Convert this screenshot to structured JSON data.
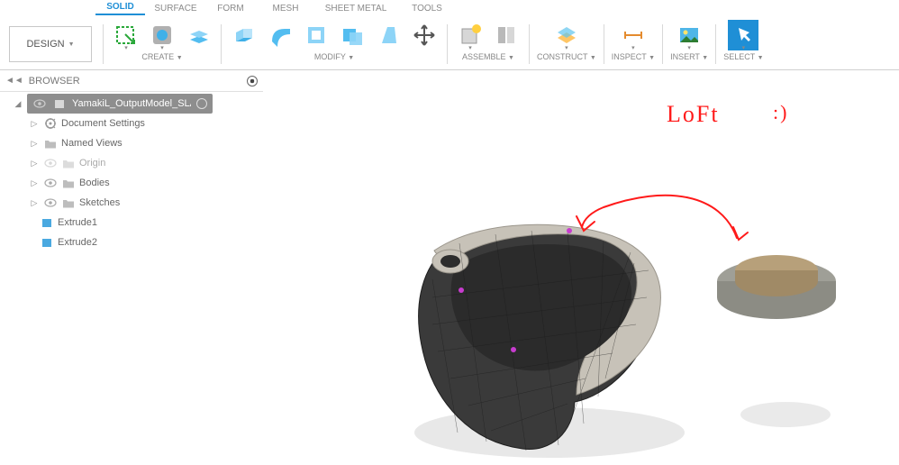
{
  "ribbon": {
    "design_label": "DESIGN",
    "tabs": {
      "solid": {
        "label": "SOLID",
        "active": true
      },
      "surface": {
        "label": "SURFACE",
        "active": false
      },
      "form": {
        "label": "FORM",
        "active": false
      },
      "mesh": {
        "label": "MESH",
        "active": false
      },
      "sheet": {
        "label": "SHEET METAL",
        "active": false
      },
      "tools": {
        "label": "TOOLS",
        "active": false
      }
    },
    "groups": {
      "create": "CREATE",
      "modify": "MODIFY",
      "assemble": "ASSEMBLE",
      "construct": "CONSTRUCT",
      "inspect": "INSPECT",
      "insert": "INSERT",
      "select": "SELECT"
    }
  },
  "browser": {
    "title": "BROWSER",
    "root": "YamakiL_OutputModel_SLA (…",
    "items": {
      "doc_settings": "Document Settings",
      "named_views": "Named Views",
      "origin": "Origin",
      "bodies": "Bodies",
      "sketches": "Sketches",
      "extrude1": "Extrude1",
      "extrude2": "Extrude2"
    }
  },
  "annotation": {
    "text": "LoFt",
    "smiley": ":)"
  },
  "colors": {
    "accent": "#1f8fd6",
    "annotation_red": "#ff1a1a"
  }
}
